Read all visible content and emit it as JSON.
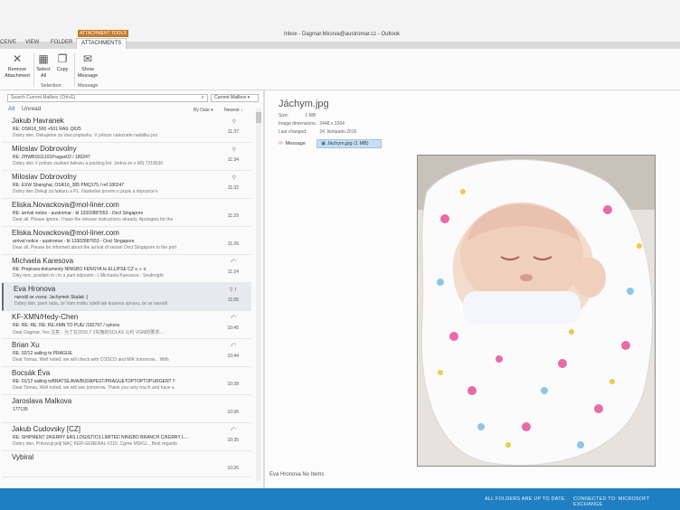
{
  "window": {
    "title": "Inbox - Dagmar.Micova@austromar.cz - Outlook",
    "context_tab": "ATTACHMENT TOOLS"
  },
  "tabs": [
    "CEIVE",
    "VIEW",
    "FOLDER",
    "ATTACHMENTS"
  ],
  "ribbon": {
    "remove_label": "Remove Attachment",
    "select_all_label": "Select All",
    "copy_label": "Copy",
    "show_message_label": "Show Message",
    "selection_group": "Selection",
    "message_group": "Message"
  },
  "list": {
    "search_placeholder": "Search Current Mailbox (Ctrl+E)",
    "mailbox_scope": "Current Mailbox",
    "filter_all": "All",
    "filter_unread": "Unread",
    "sort_by": "By Date",
    "sort_order": "Newest",
    "messages": [
      {
        "sender": "Jakub Havranek",
        "subject": "RE: OSR16_500 +501 RAIL Q625",
        "preview": "Dobry den, Dekujeme za Vasi poptavku. V priloze naleznete nabidku pro",
        "time": "11:37",
        "icon": "attachment"
      },
      {
        "sender": "Miloslav Dobrovolny",
        "subject": "RE: ZHWB1611101Prague02 / 180247",
        "preview": "Dobry den V priloze zasilam fakturu a packing list. Jedna se o MS 7318630",
        "time": "11:34",
        "icon": "attachment"
      },
      {
        "sender": "Miloslav Dobrovolny",
        "subject": "RE: EXW Shanghai, OSR16_385 PMQ175 / ref 180247",
        "preview": "Dobry den Dekuji za fakturu a PL. Nasledne provim o popis a dopozice k",
        "time": "11:32",
        "icon": "attachment"
      },
      {
        "sender": "Eliska.Novackova@mol-liner.com",
        "subject": "RE: arrival notice - austromar - bl 13302887653 - Oocl Singapore",
        "preview": "Dear all, Please ignore, I have the release instructions already. Apologies for the",
        "time": "11:29",
        "icon": ""
      },
      {
        "sender": "Eliska.Novackova@mol-liner.com",
        "subject": "arrival notice - austromar - bl 13302887653 - Oocl Singapore",
        "preview": "Dear all, Please be informed about the arrival of vessel Oocl Singapore to the port",
        "time": "11:26",
        "icon": ""
      },
      {
        "sender": "Michaela Karesova",
        "subject": "RE: Preprava-dokumenty NINGBO FENGYA to ELLIPSE CZ s. r. o.",
        "preview": "Diky moc, posilam to i to a pani odpovim :-) Michaela Karesova - Seafreight",
        "time": "11:24",
        "icon": "reply"
      },
      {
        "sender": "Eva Hronova",
        "subject": "narodil se vcera: Jachymek Skalak :)",
        "preview": "Dobry den, jsem rada, ze Vam mohu zdelit tak krasnou zpravu, ze se narodil",
        "time": "11:05",
        "icon": "attachment-flag"
      },
      {
        "sender": "KF-XMN/Hedy-Chen",
        "subject": "RE: RE: RE: RE: RE:XMN TO PUE/ /182767 / sykora",
        "preview": "Dear Dagmar, Yes 注意：为了在2016.7.1实施的SOLAS 公约 VGM的要求...",
        "time": "10:45",
        "icon": "reply"
      },
      {
        "sender": "Brian Xu",
        "subject": "RE: 02/12 sailing to PRAGUE",
        "preview": "Dear Tomas, Well noted, we will check with COSCO and MIK tomorrow... With",
        "time": "10:44",
        "icon": "reply"
      },
      {
        "sender": "Bocsák Éva",
        "subject": "RE: 01/12 sailing toBRATISLAVA/BUDAPEST/PRAGUETOPTOPTOPURGENT !!",
        "preview": "Dear Tomas, Well noted, we will see tomorrow. Thank you very much and have a",
        "time": "10:38",
        "icon": ""
      },
      {
        "sender": "Jaroslava Malkova",
        "subject": "177135",
        "preview": "",
        "time": "10:36",
        "icon": ""
      },
      {
        "sender": "Jakub Cudovsky [CZ]",
        "subject": "RE: SHIPMENT 2/KERRY EAS LOGISTICS LIMITED NINGBO BRANCH C/KERRY L...",
        "preview": "Dobry den, Potvrzuji prijl NAC KER-GENERAL-0115. Cgree MSKU... Best regards",
        "time": "10:35",
        "icon": "reply"
      },
      {
        "sender": "Vybiral",
        "subject": "",
        "preview": "",
        "time": "10:26",
        "icon": ""
      }
    ]
  },
  "reading": {
    "attachment_name": "Jáchym.jpg",
    "size_label": "Size:",
    "size_value": "1 MB",
    "dims_label": "Image dimensions:",
    "dims_value": "2448 x 3264",
    "changed_label": "Last changed:",
    "changed_value": "24. listopadu 2016",
    "message_tab": "Message",
    "attachment_chip": "Jáchym.jpg (1 MB)",
    "sender_line": "Eva Hronova  No Items"
  },
  "status": {
    "left": "ALL FOLDERS ARE UP TO DATE.",
    "right": "CONNECTED TO: MICROSOFT EXCHANGE"
  },
  "colors": {
    "accent": "#1f7fc2",
    "context_tab": "#c77b2a",
    "chip": "#c9dff2"
  }
}
